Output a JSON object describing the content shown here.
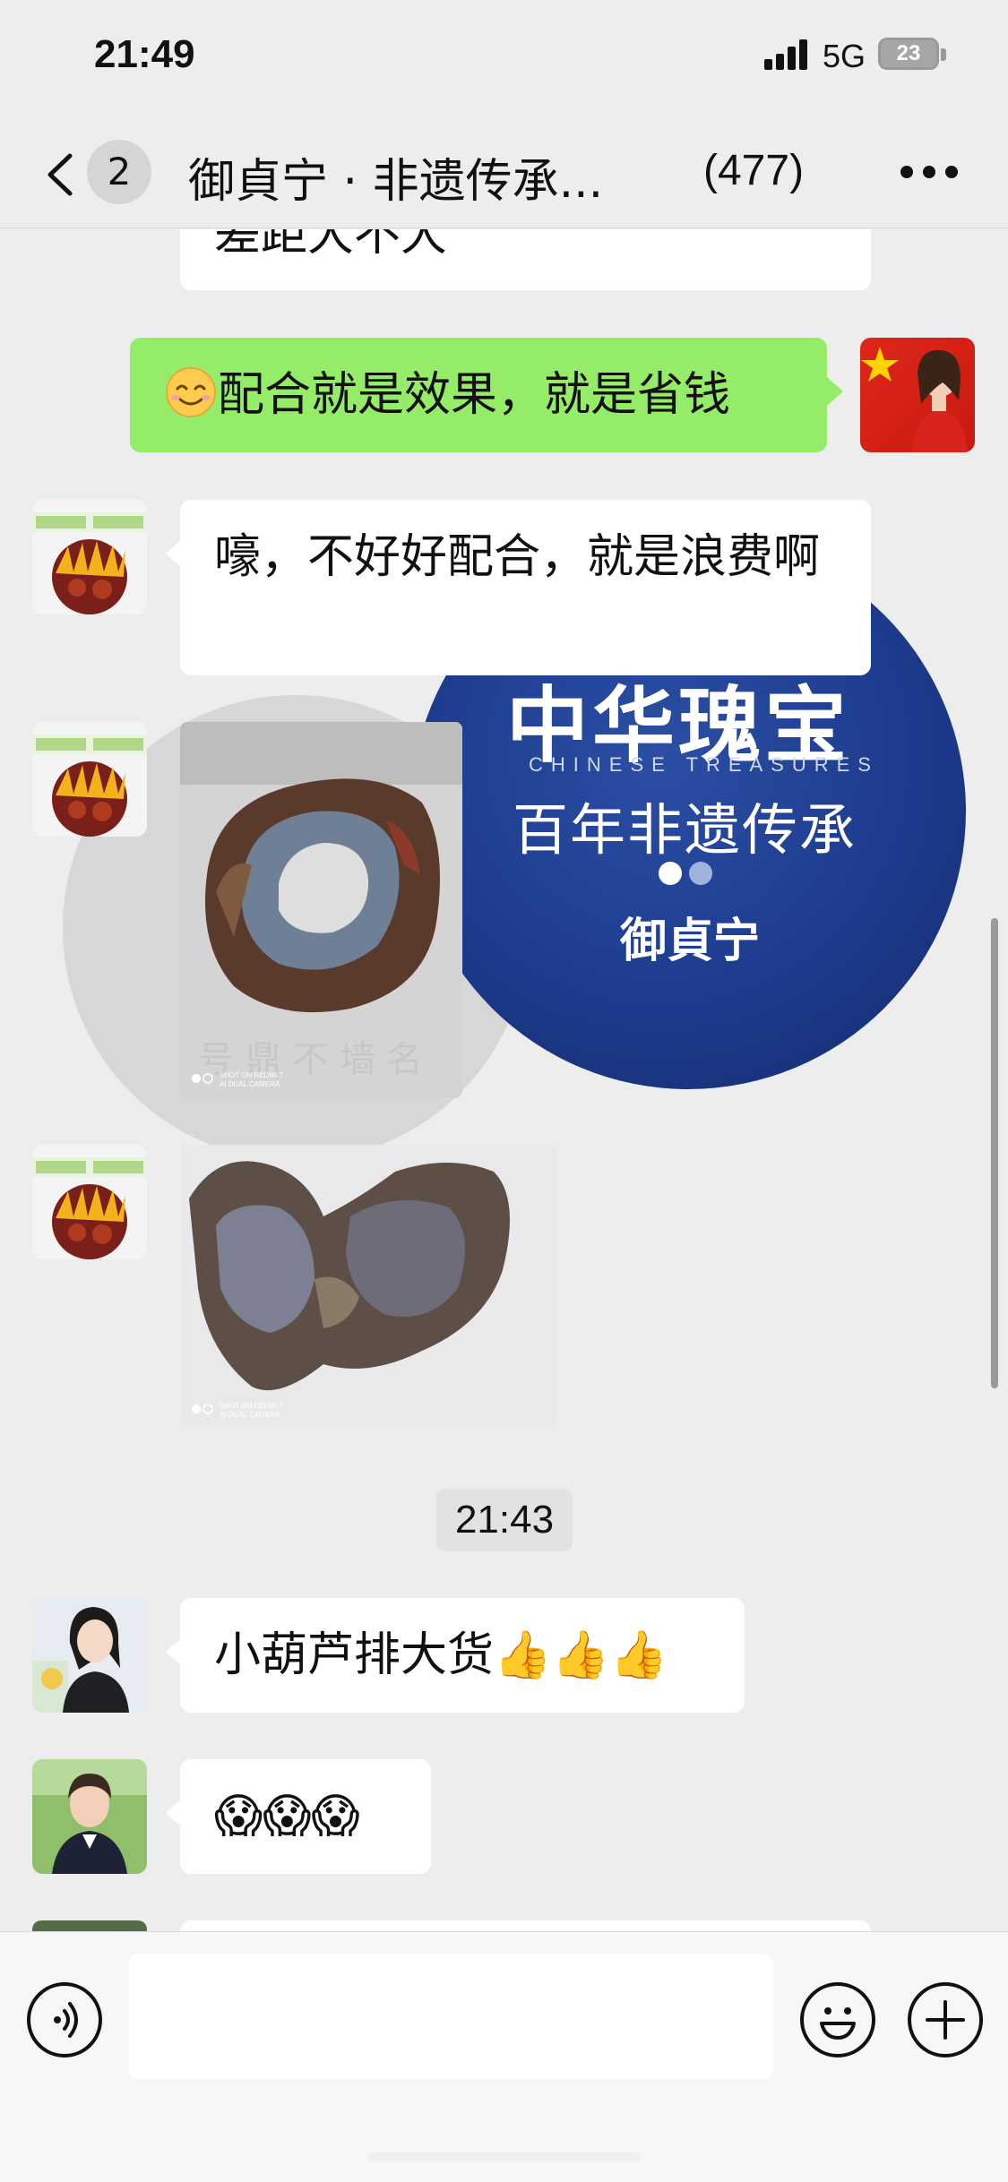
{
  "status_bar": {
    "time": "21:49",
    "network": "5G",
    "battery": "23"
  },
  "nav": {
    "back_icon": "chevron-left-icon",
    "unread_count": "2",
    "title": "御貞宁 · 非遗传承...",
    "member_count": "(477)",
    "more_icon": "more-dots-icon"
  },
  "messages": [
    {
      "id": "m0",
      "side": "left",
      "type": "text",
      "text": "差距大不大"
    },
    {
      "id": "m1",
      "side": "right",
      "type": "text",
      "emoji": "smile-emoji",
      "text": "配合就是效果，就是省钱"
    },
    {
      "id": "m2",
      "side": "left",
      "type": "text",
      "text": "嚎，不好好配合，就是浪费啊"
    },
    {
      "id": "m3",
      "side": "left",
      "type": "image",
      "caption_line1": "SHOT ON REDMI 7",
      "caption_line2": "AI DUAL CAMERA"
    },
    {
      "id": "m4",
      "side": "left",
      "type": "image",
      "caption_line1": "SHOT ON REDMI 7",
      "caption_line2": "AI DUAL CAMERA"
    },
    {
      "id": "m5",
      "side": "left",
      "type": "text",
      "text": "小葫芦排大货👍👍👍"
    },
    {
      "id": "m6",
      "side": "left",
      "type": "text",
      "text": "😱😱😱"
    }
  ],
  "time_divider": "21:43",
  "promo": {
    "title": "中华瑰宝",
    "subtitle_en": "CHINESE TREASURES",
    "subtitle": "百年非遗传承",
    "brand": "御貞宁"
  },
  "input_bar": {
    "voice_icon": "voice-icon",
    "emoji_icon": "emoji-icon",
    "plus_icon": "plus-icon",
    "placeholder": ""
  },
  "colors": {
    "background": "#ededed",
    "self_bubble": "#95ec69",
    "other_bubble": "#ffffff",
    "promo_blue": "#1d3b8d"
  }
}
